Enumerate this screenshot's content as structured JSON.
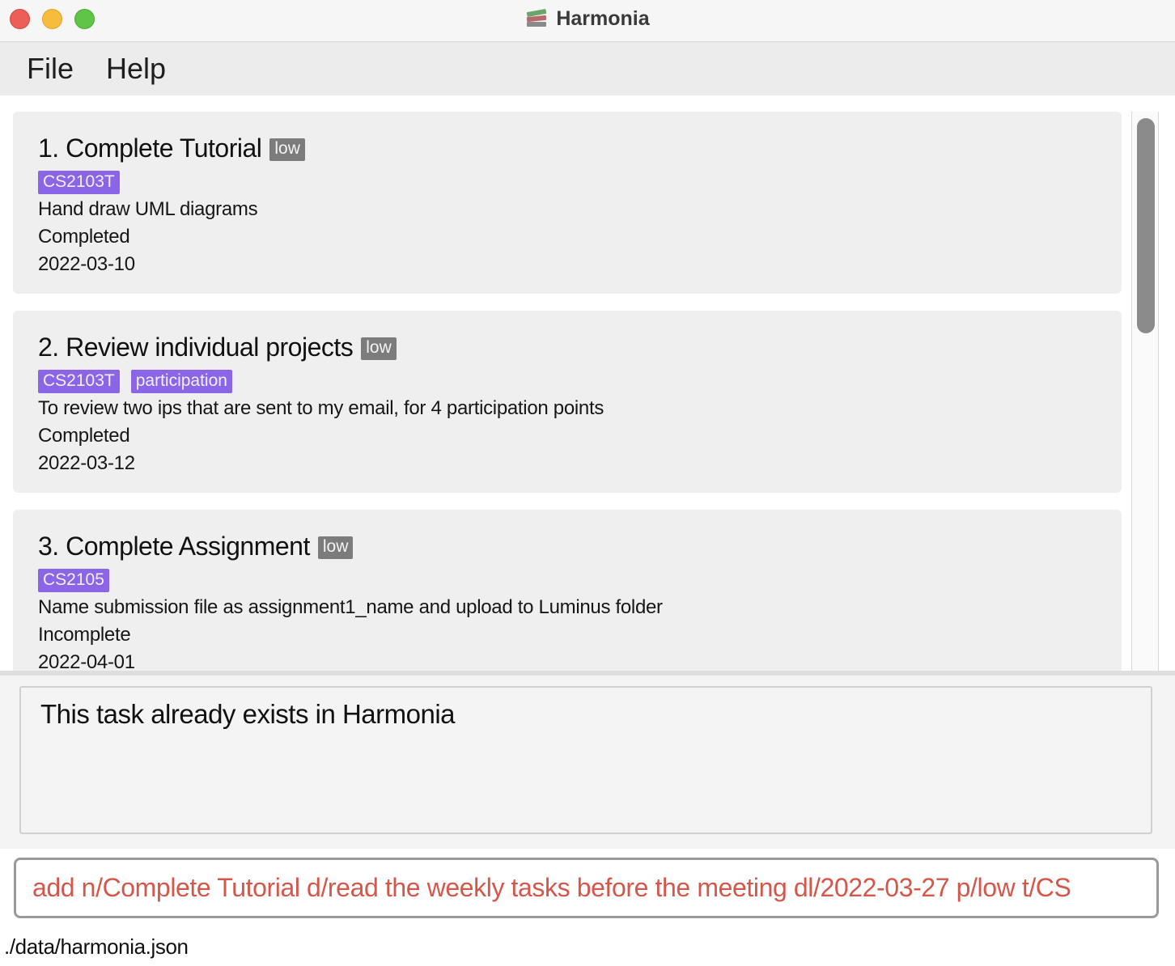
{
  "window": {
    "title": "Harmonia",
    "icon": "books-icon"
  },
  "menu": {
    "items": [
      {
        "label": "File"
      },
      {
        "label": "Help"
      }
    ]
  },
  "tasks": [
    {
      "title": "1. Complete Tutorial",
      "priority": "low",
      "tags": [
        "CS2103T"
      ],
      "description": "Hand draw UML diagrams",
      "status": "Completed",
      "deadline": "2022-03-10"
    },
    {
      "title": "2. Review individual projects",
      "priority": "low",
      "tags": [
        "CS2103T",
        "participation"
      ],
      "description": "To review two ips that are sent to my email, for 4 participation points",
      "status": "Completed",
      "deadline": "2022-03-12"
    },
    {
      "title": "3. Complete Assignment",
      "priority": "low",
      "tags": [
        "CS2105"
      ],
      "description": "Name submission file as assignment1_name and upload to Luminus folder",
      "status": "Incomplete",
      "deadline": "2022-04-01"
    }
  ],
  "result": {
    "message": "This task already exists in Harmonia"
  },
  "command": {
    "value": "add n/Complete Tutorial d/read the weekly tasks before the meeting dl/2022-03-27 p/low t/CS"
  },
  "status_bar": {
    "file_path": "./data/harmonia.json"
  },
  "colors": {
    "tag": "#8a65e6",
    "priority": "#7c7c7c",
    "command_error_text": "#d4574a"
  }
}
